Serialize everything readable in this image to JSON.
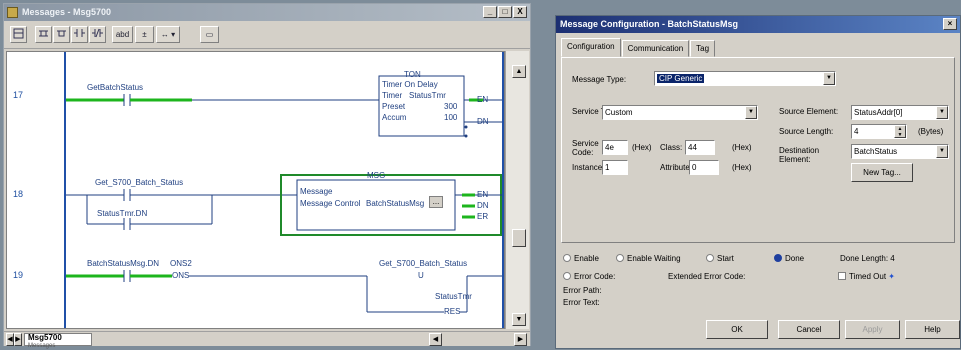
{
  "ladder_window": {
    "title": "Messages - Msg5700",
    "window_buttons": [
      "_",
      "□",
      "X"
    ],
    "toolbar": {
      "b5": "abd",
      "b6": "±",
      "b7": "↔ ▾",
      "b8": "▭"
    },
    "rungs": [
      {
        "num": "17",
        "contact": "GetBatchStatus",
        "block_title": "TON",
        "block_name": "Timer On Delay",
        "timer_label": "Timer",
        "timer_value": "StatusTmr",
        "preset_label": "Preset",
        "preset_value": "300",
        "accum_label": "Accum",
        "accum_value": "100",
        "out_en": "EN",
        "out_dn": "DN"
      },
      {
        "num": "18",
        "contact": "Get_S700_Batch_Status",
        "branch_contact": "StatusTmr.DN",
        "block_title": "MSG",
        "block_name": "Message",
        "ctrl_label": "Message Control",
        "ctrl_value": "BatchStatusMsg",
        "ctrl_btn": "...",
        "out_en": "EN",
        "out_dn": "DN",
        "out_er": "ER"
      },
      {
        "num": "19",
        "contact": "BatchStatusMsg.DN",
        "ons": "ONS2",
        "ons_type": "ONS",
        "coil_tag": "Get_S700_Batch_Status",
        "coil": "U",
        "res_tag": "StatusTmr",
        "res": "RES"
      }
    ],
    "tab": "Msg5700",
    "tab_sub": "Messages"
  },
  "dialog": {
    "title": "Message Configuration - BatchStatusMsg",
    "tabs": [
      "Configuration",
      "Communication",
      "Tag"
    ],
    "message_type_label": "Message Type:",
    "message_type": "CIP Generic",
    "service_type_label": "Service Type:",
    "service_type": "Custom",
    "service_code_label": "Service Code:",
    "service_code": "4e",
    "hex": "(Hex)",
    "class_label": "Class:",
    "class_value": "44",
    "instance_label": "Instance:",
    "instance": "1",
    "attribute_label": "Attribute:",
    "attribute": "0",
    "source_element_label": "Source Element:",
    "source_element": "StatusAddr[0]",
    "source_length_label": "Source Length:",
    "source_length": "4",
    "bytes": "(Bytes)",
    "destination_label": "Destination Element:",
    "destination": "BatchStatus",
    "new_tag": "New Tag...",
    "status": {
      "enable": "Enable",
      "enable_waiting": "Enable Waiting",
      "start": "Start",
      "done": "Done",
      "done_length": "Done Length: 4"
    },
    "error_code": "Error Code:",
    "extended_error_code": "Extended Error Code:",
    "timed_out": "Timed Out",
    "error_path": "Error Path:",
    "error_text": "Error Text:",
    "buttons": {
      "ok": "OK",
      "cancel": "Cancel",
      "apply": "Apply",
      "help": "Help"
    }
  }
}
